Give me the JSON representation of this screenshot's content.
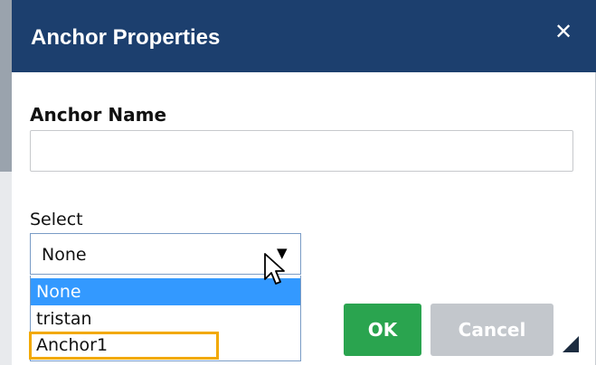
{
  "dialog": {
    "title": "Anchor Properties",
    "close_label": "✕"
  },
  "form": {
    "anchor_name_label": "Anchor Name",
    "anchor_name_value": "",
    "select_label": "Select",
    "select_value": "None",
    "select_arrow": "▼",
    "options": [
      "None",
      "tristan",
      "Anchor1"
    ],
    "selected_index": 0,
    "highlighted_option": "Anchor1"
  },
  "buttons": {
    "ok_label": "OK",
    "cancel_label": "Cancel"
  },
  "colors": {
    "titlebar": "#1c3f6e",
    "ok": "#2aa44f",
    "cancel": "#c3c7cc",
    "selected_option": "#3399ff",
    "highlight": "#f2a900"
  },
  "icons": {
    "close": "close-icon",
    "cursor": "mouse-cursor-icon",
    "dropdown": "dropdown-arrow-icon",
    "resize": "resize-grip-icon"
  }
}
